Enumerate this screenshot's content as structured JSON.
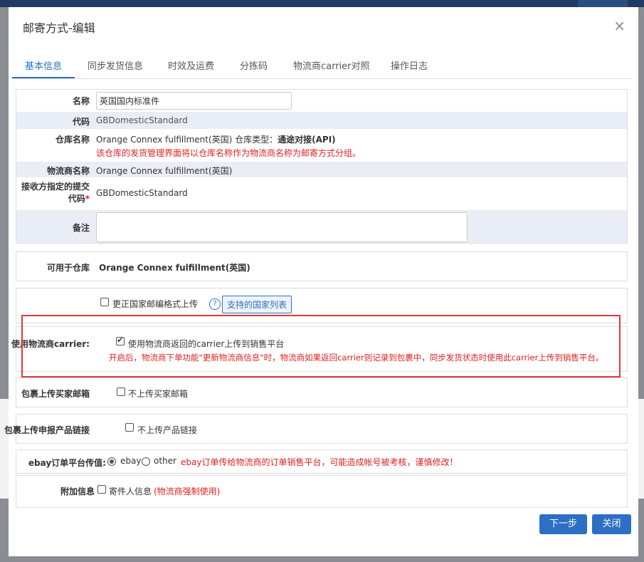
{
  "dialog": {
    "title": "邮寄方式-编辑",
    "close_glyph": "×"
  },
  "tabs": [
    {
      "label": "基本信息",
      "active": true
    },
    {
      "label": "同步发货信息"
    },
    {
      "label": "时效及运费"
    },
    {
      "label": "分拣码"
    },
    {
      "label": "物流商carrier对照"
    },
    {
      "label": "操作日志"
    }
  ],
  "basic": {
    "name_label": "名称",
    "name_value": "英国国内标准件",
    "code_label": "代码",
    "code_value": "GBDomesticStandard",
    "warehouse_label": "仓库名称",
    "warehouse_value": "Orange Connex fulfillment(英国) 仓库类型：",
    "warehouse_type": "通途对接(API)",
    "warehouse_note": "该仓库的发货管理界面将以仓库名称作为物流商名称为邮寄方式分组。",
    "carrier_name_label": "物流商名称",
    "carrier_name_value": "Orange Connex fulfillment(英国)",
    "recv_code_label_1": "接收方指定的提交",
    "recv_code_label_2": "代码",
    "required_mark": "*",
    "recv_code_value": "GBDomesticStandard",
    "remark_label": "备注"
  },
  "available_warehouse": {
    "label": "可用于仓库",
    "value": "Orange Connex fulfillment(英国)"
  },
  "postal": {
    "checkbox_label": "更正国家邮编格式上传",
    "help_glyph": "?",
    "button_label": "支持的国家列表"
  },
  "carrier": {
    "label": "使用物流商carrier:",
    "checkbox_label": "使用物流商返回的carrier上传到销售平台",
    "checked": true,
    "note": "开启后，物流商下单功能\"更新物流商信息\"时，物流商如果返回carrier则记录到包裹中，同步发货状态时使用此carrier上传到销售平台。"
  },
  "buyer_email": {
    "label": "包裹上传买家邮箱",
    "checkbox_label": "不上传买家邮箱"
  },
  "product_link": {
    "label": "包裹上传申报产品链接",
    "checkbox_label": "不上传产品链接"
  },
  "ebay": {
    "label": "ebay订单平台传值:",
    "options": [
      "ebay",
      "other"
    ],
    "selected": "ebay",
    "warning": "ebay订单传给物流商的订单销售平台，可能造成帐号被考核，谨慎修改！"
  },
  "extra": {
    "label": "附加信息",
    "checkbox_label": "寄件人信息",
    "note": "(物流商强制使用)"
  },
  "buttons": {
    "next": "下一步",
    "close": "关闭"
  },
  "colors": {
    "primary": "#2d6fc4",
    "warning_red": "#e02020",
    "highlight_border": "#e53935"
  }
}
